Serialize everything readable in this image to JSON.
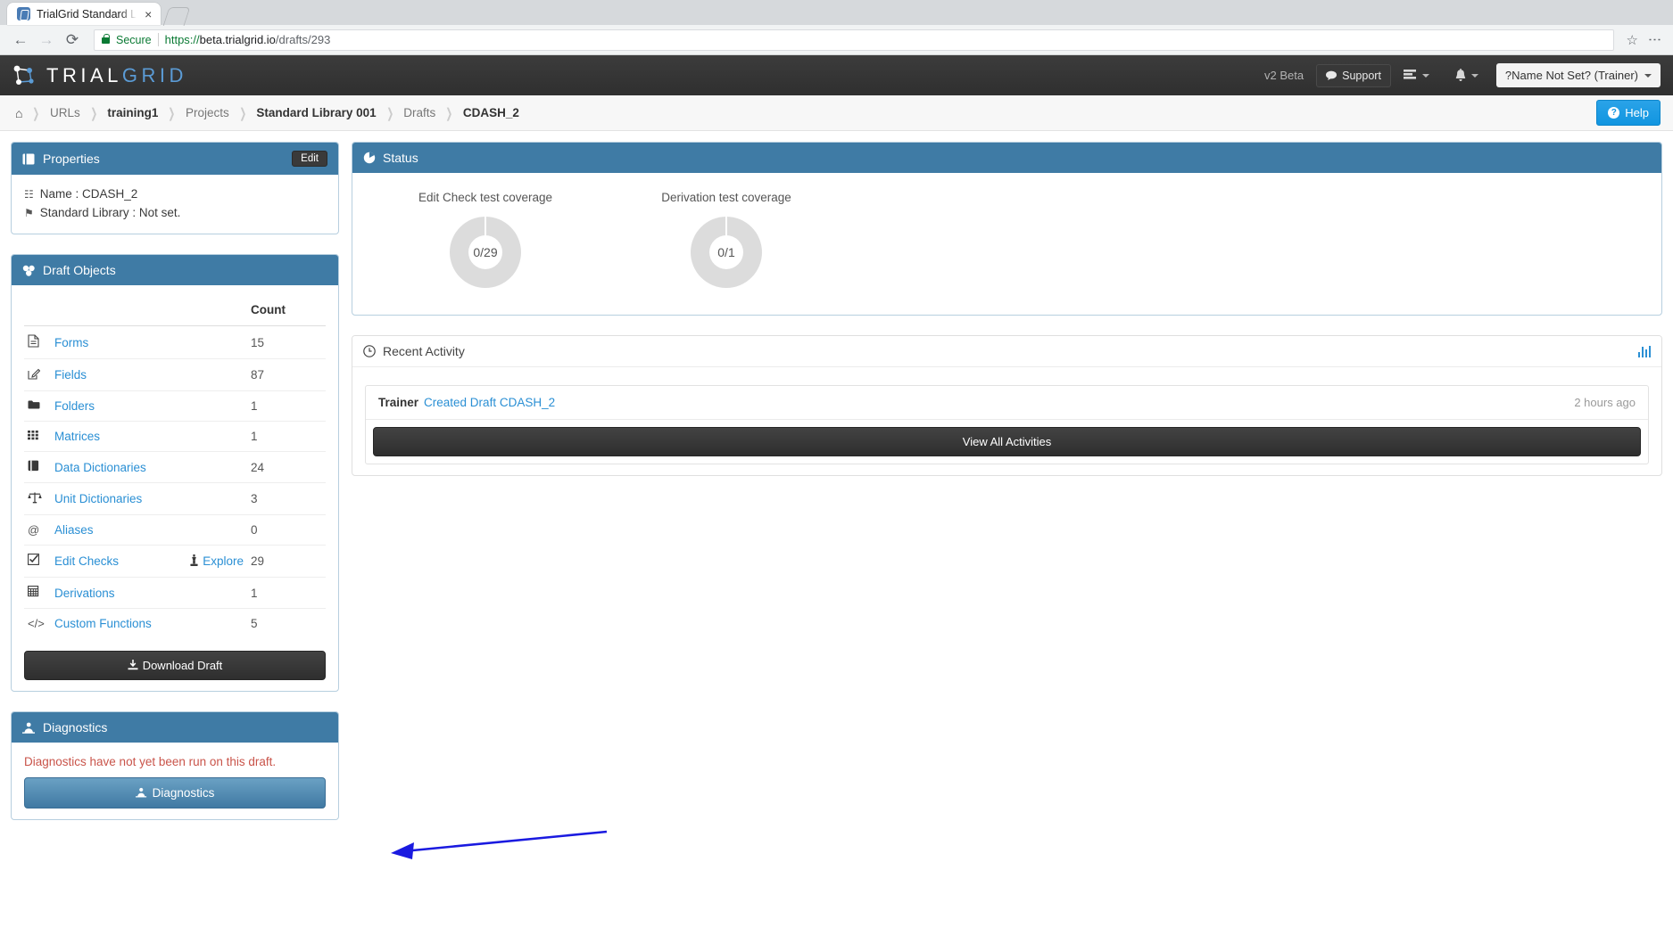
{
  "browser": {
    "tab_title": "TrialGrid Standard L",
    "tab_close": "×",
    "back_icon": "←",
    "forward_icon": "→",
    "reload_icon": "⟳",
    "secure_label": "Secure",
    "url_scheme": "https://",
    "url_host": "beta.trialgrid.io",
    "url_path": "/drafts/293",
    "star_icon": "☆",
    "kebab_icon": "⋮"
  },
  "navbar": {
    "brand_first": "TRIAL",
    "brand_second": "GRID",
    "version": "v2 Beta",
    "support_label": "Support",
    "tasks_icon": "tasks-icon",
    "bell_icon": "🔔",
    "user_label": "?Name Not Set? (Trainer)"
  },
  "breadcrumb": {
    "home_icon": "⌂",
    "items": [
      {
        "label": "URLs",
        "bold": false
      },
      {
        "label": "training1",
        "bold": true
      },
      {
        "label": "Projects",
        "bold": false
      },
      {
        "label": "Standard Library 001",
        "bold": true
      },
      {
        "label": "Drafts",
        "bold": false
      },
      {
        "label": "CDASH_2",
        "bold": true
      }
    ],
    "separator": "❯",
    "help_label": "Help",
    "help_mark": "?"
  },
  "properties_panel": {
    "title": "Properties",
    "edit_label": "Edit",
    "rows": [
      {
        "icon": "☷",
        "text": "Name : CDASH_2"
      },
      {
        "icon": "⚑",
        "text": "Standard Library : Not set."
      }
    ]
  },
  "draft_objects_panel": {
    "title": "Draft Objects",
    "count_header": "Count",
    "explore_label": "Explore",
    "rows": [
      {
        "icon": "὜b",
        "name": "Forms",
        "count": "15",
        "explore": false
      },
      {
        "icon": "✎",
        "name": "Fields",
        "count": "87",
        "explore": false
      },
      {
        "icon": "▮",
        "name": "Folders",
        "count": "1",
        "explore": false
      },
      {
        "icon": "░",
        "name": "Matrices",
        "count": "1",
        "explore": false
      },
      {
        "icon": "Ὅ5",
        "name": "Data Dictionaries",
        "count": "24",
        "explore": false
      },
      {
        "icon": "⚖",
        "name": "Unit Dictionaries",
        "count": "3",
        "explore": false
      },
      {
        "icon": "@",
        "name": "Aliases",
        "count": "0",
        "explore": false
      },
      {
        "icon": "☑",
        "name": "Edit Checks",
        "count": "29",
        "explore": true
      },
      {
        "icon": "▦",
        "name": "Derivations",
        "count": "1",
        "explore": false
      },
      {
        "icon": "</>",
        "name": "Custom Functions",
        "count": "5",
        "explore": false
      }
    ],
    "download_label": "Download Draft"
  },
  "diagnostics_panel": {
    "title": "Diagnostics",
    "note": "Diagnostics have not yet been run on this draft.",
    "button_label": "Diagnostics"
  },
  "status_panel": {
    "title": "Status",
    "donuts": [
      {
        "label": "Edit Check test coverage",
        "value": "0/29"
      },
      {
        "label": "Derivation test coverage",
        "value": "0/1"
      }
    ]
  },
  "activity_panel": {
    "title": "Recent Activity",
    "items": [
      {
        "user": "Trainer",
        "action": "Created Draft CDASH_2",
        "time": "2 hours ago"
      }
    ],
    "view_all_label": "View All Activities"
  },
  "chart_data": {
    "type": "pie",
    "title": "Status test coverage donuts",
    "charts": [
      {
        "name": "Edit Check test coverage",
        "covered": 0,
        "total": 29,
        "percent": 0,
        "display": "0/29",
        "color_empty": "#dcdcdc"
      },
      {
        "name": "Derivation test coverage",
        "covered": 0,
        "total": 1,
        "percent": 0,
        "display": "0/1",
        "color_empty": "#dcdcdc"
      }
    ]
  },
  "colors": {
    "panel_header": "#3f7ba5",
    "link": "#2a8fd4",
    "accent_help": "#1195e0",
    "danger_text": "#c9544a",
    "donut_empty": "#dcdcdc",
    "annotation_arrow": "#1a1ae0"
  }
}
